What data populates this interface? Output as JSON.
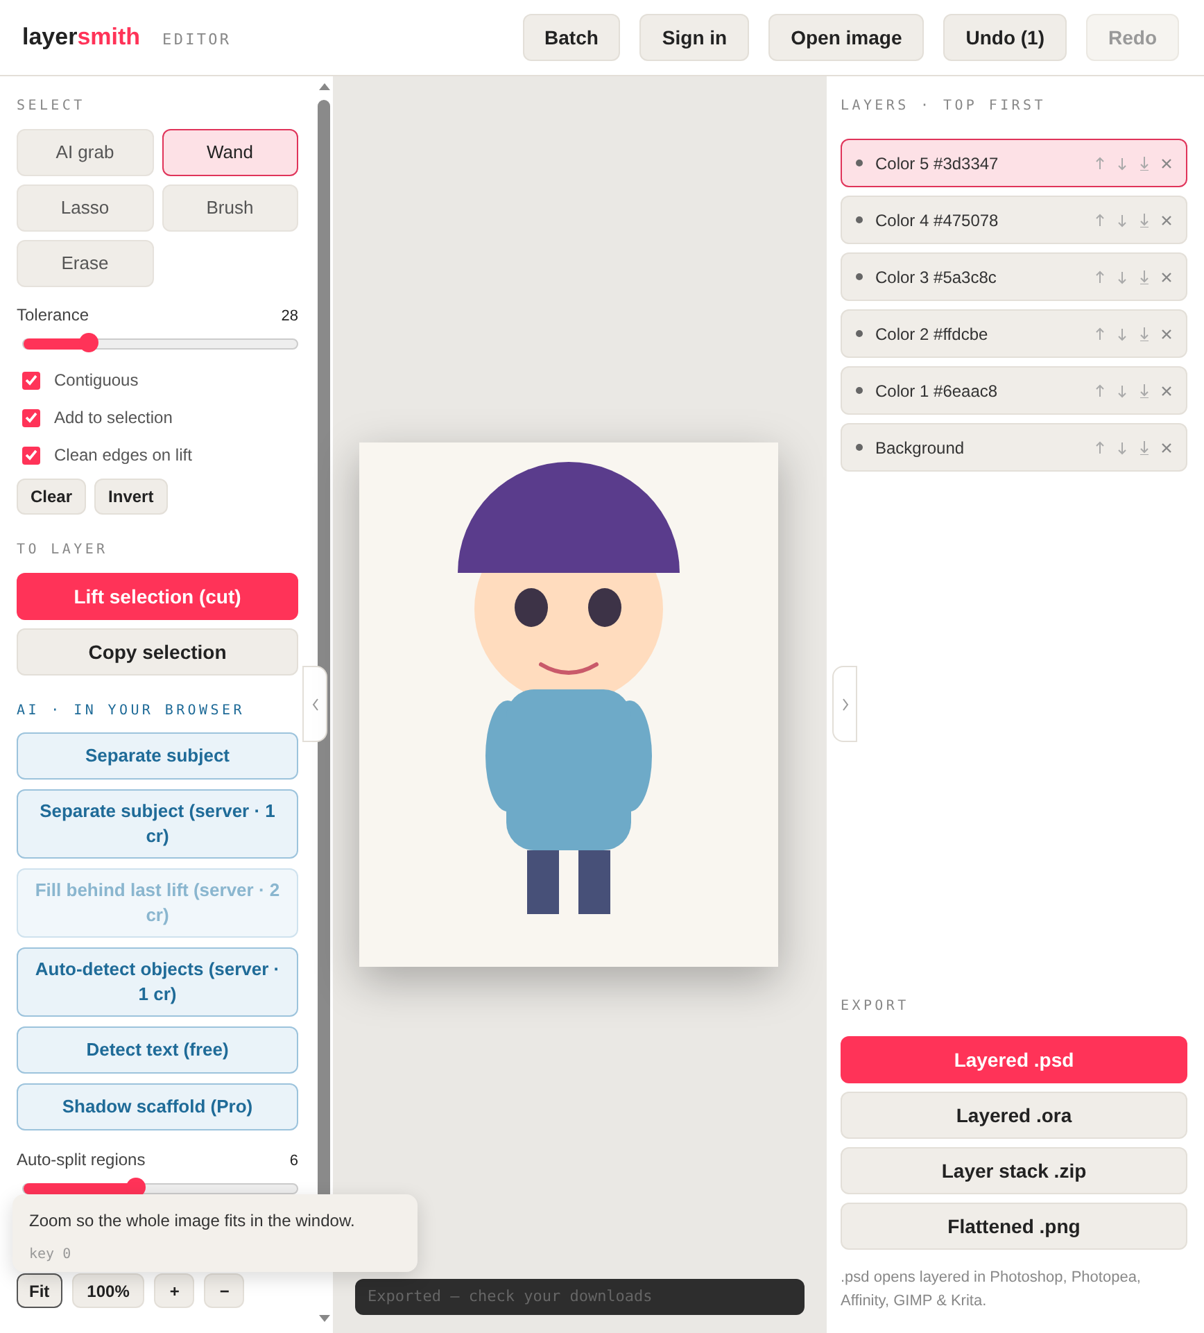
{
  "header": {
    "logo_prefix": "layer",
    "logo_suffix": "smith",
    "badge": "EDITOR",
    "toolbar": [
      {
        "label": "Batch",
        "disabled": false
      },
      {
        "label": "Sign in",
        "disabled": false
      },
      {
        "label": "Open image",
        "disabled": false
      },
      {
        "label": "Undo (1)",
        "disabled": false
      },
      {
        "label": "Redo",
        "disabled": true
      }
    ]
  },
  "left_panel": {
    "select_heading": "SELECT",
    "tools": [
      {
        "label": "AI grab",
        "selected": false
      },
      {
        "label": "Wand",
        "selected": true
      },
      {
        "label": "Lasso",
        "selected": false
      },
      {
        "label": "Brush",
        "selected": false
      },
      {
        "label": "Erase",
        "selected": false
      }
    ],
    "tolerance": {
      "label": "Tolerance",
      "reading": "28",
      "level": 0.24
    },
    "options": [
      {
        "label": "Contiguous",
        "checked": true
      },
      {
        "label": "Add to selection",
        "checked": true
      },
      {
        "label": "Clean edges on lift",
        "checked": true
      }
    ],
    "selection_buttons": [
      "Clear",
      "Invert"
    ],
    "to_layer_heading": "TO LAYER",
    "layer_actions": [
      {
        "label": "Lift selection (cut)",
        "primary": true
      },
      {
        "label": "Copy selection",
        "primary": false
      }
    ],
    "ai_heading": "AI · IN YOUR BROWSER",
    "ai_actions": [
      {
        "label": "Separate subject",
        "disabled": false
      },
      {
        "label": "Separate subject (server · 1 cr)",
        "disabled": false
      },
      {
        "label": "Fill behind last lift (server · 2 cr)",
        "disabled": true
      },
      {
        "label": "Auto-detect objects (server · 1 cr)",
        "disabled": false
      },
      {
        "label": "Detect text (free)",
        "disabled": false
      },
      {
        "label": "Shadow scaffold (Pro)",
        "disabled": false
      }
    ],
    "auto_split": {
      "label": "Auto-split regions",
      "reading": "6",
      "level": 0.41
    },
    "view_buttons": [
      {
        "label": "Fit",
        "selected": true
      },
      {
        "label": "100%",
        "selected": false
      },
      {
        "label": "+",
        "selected": false
      },
      {
        "label": "−",
        "selected": false
      }
    ]
  },
  "tooltip": {
    "text": "Zoom so the whole image fits in the window.",
    "hint": "key 0"
  },
  "toast": "Exported — check your downloads",
  "layers_panel": {
    "heading": "LAYERS · TOP FIRST",
    "layers": [
      {
        "name": "Color 5 #3d3347",
        "selected": true
      },
      {
        "name": "Color 4 #475078",
        "selected": false
      },
      {
        "name": "Color 3 #5a3c8c",
        "selected": false
      },
      {
        "name": "Color 2 #ffdcbe",
        "selected": false
      },
      {
        "name": "Color 1 #6eaac8",
        "selected": false
      },
      {
        "name": "Background",
        "selected": false
      }
    ]
  },
  "export": {
    "heading": "EXPORT",
    "buttons": [
      {
        "label": "Layered .psd",
        "primary": true
      },
      {
        "label": "Layered .ora",
        "primary": false
      },
      {
        "label": "Layer stack .zip",
        "primary": false
      },
      {
        "label": "Flattened .png",
        "primary": false
      }
    ],
    "note": ".psd opens layered in Photoshop, Photopea, Affinity, GIMP & Krita."
  }
}
